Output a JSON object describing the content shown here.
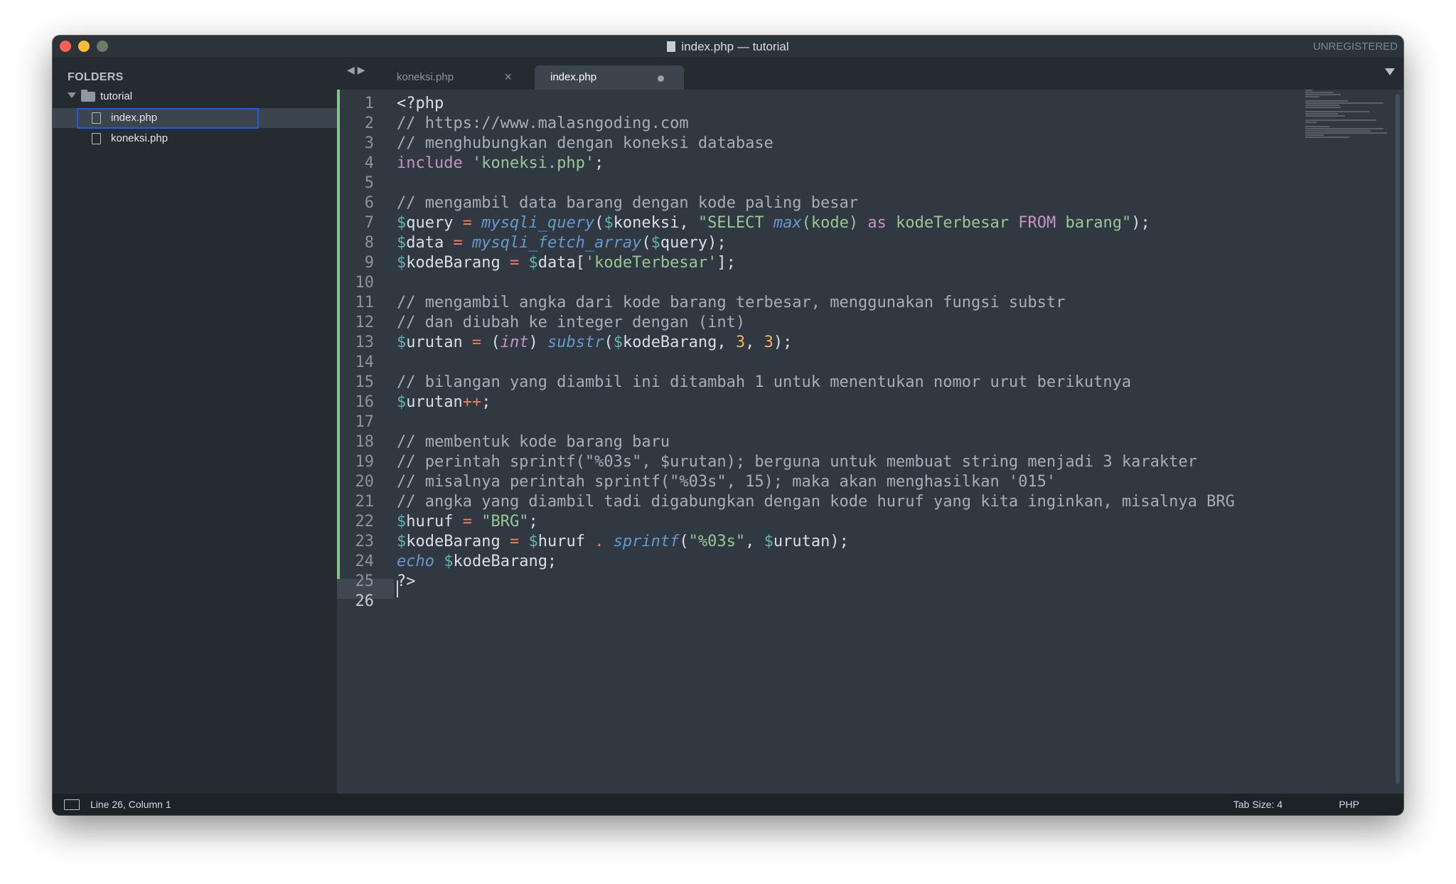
{
  "window": {
    "title": "index.php — tutorial",
    "registration": "UNREGISTERED"
  },
  "sidebar": {
    "heading": "FOLDERS",
    "folder_name": "tutorial",
    "files": [
      "index.php",
      "koneksi.php"
    ]
  },
  "tabs": [
    {
      "label": "koneksi.php",
      "close": "×"
    },
    {
      "label": "index.php",
      "modified": true
    }
  ],
  "editor": {
    "line_numbers": [
      "1",
      "2",
      "3",
      "4",
      "5",
      "6",
      "7",
      "8",
      "9",
      "10",
      "11",
      "12",
      "13",
      "14",
      "15",
      "16",
      "17",
      "18",
      "19",
      "20",
      "21",
      "22",
      "23",
      "24",
      "25",
      "26"
    ],
    "current_line": "26"
  },
  "status": {
    "position": "Line 26, Column 1",
    "tab_size": "Tab Size: 4",
    "syntax": "PHP"
  },
  "colors": {
    "editor_bg": "#303841",
    "sidebar_bg": "#252b31",
    "comment": "#a7adba",
    "keyword": "#c594c5",
    "string": "#99c794",
    "function": "#6699cc",
    "variable_sigil": "#5fb3b3",
    "operator": "#f97b58",
    "number": "#f9ae58",
    "selection_outline": "#1d5ce6"
  }
}
